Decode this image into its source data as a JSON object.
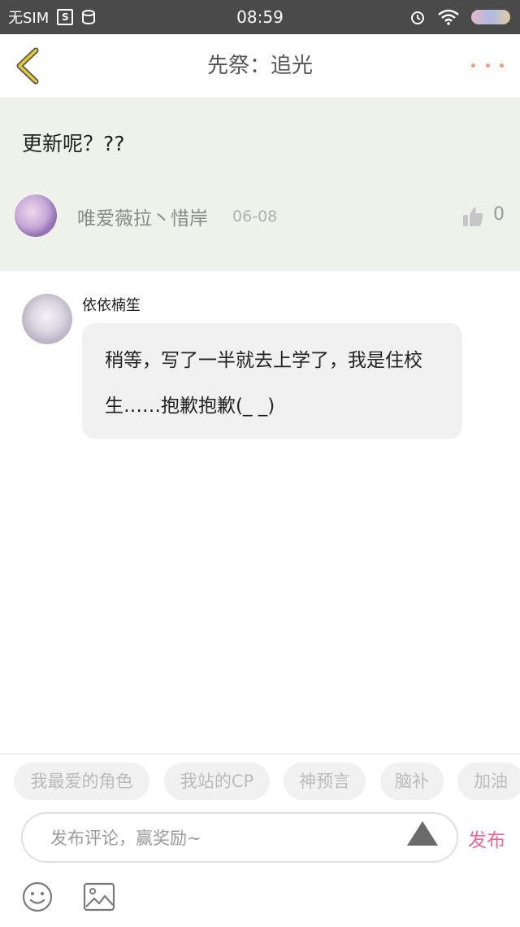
{
  "status_bar": {
    "carrier": "无SIM",
    "sim_icon_label": "S",
    "time": "08:59"
  },
  "nav": {
    "title": "先祭：追光",
    "back_icon": "chevron-left-icon",
    "more_icon": "more-dots-icon"
  },
  "post": {
    "text": "更新呢？??",
    "author": "唯爱薇拉丶惜岸",
    "date": "06-08",
    "like_count": "0"
  },
  "reply": {
    "author": "依依楠笙",
    "text": "稍等，写了一半就去上学了，我是住校生……抱歉抱歉(_ _)"
  },
  "quick_tags": [
    "我最爱的角色",
    "我站的CP",
    "神预言",
    "脑补",
    "加油"
  ],
  "composer": {
    "placeholder": "发布评论，赢奖励~",
    "publish_label": "发布"
  },
  "colors": {
    "accent_pink": "#e86a9a",
    "nav_back_yellow": "#e6c830",
    "post_bg": "#eff2ea"
  }
}
